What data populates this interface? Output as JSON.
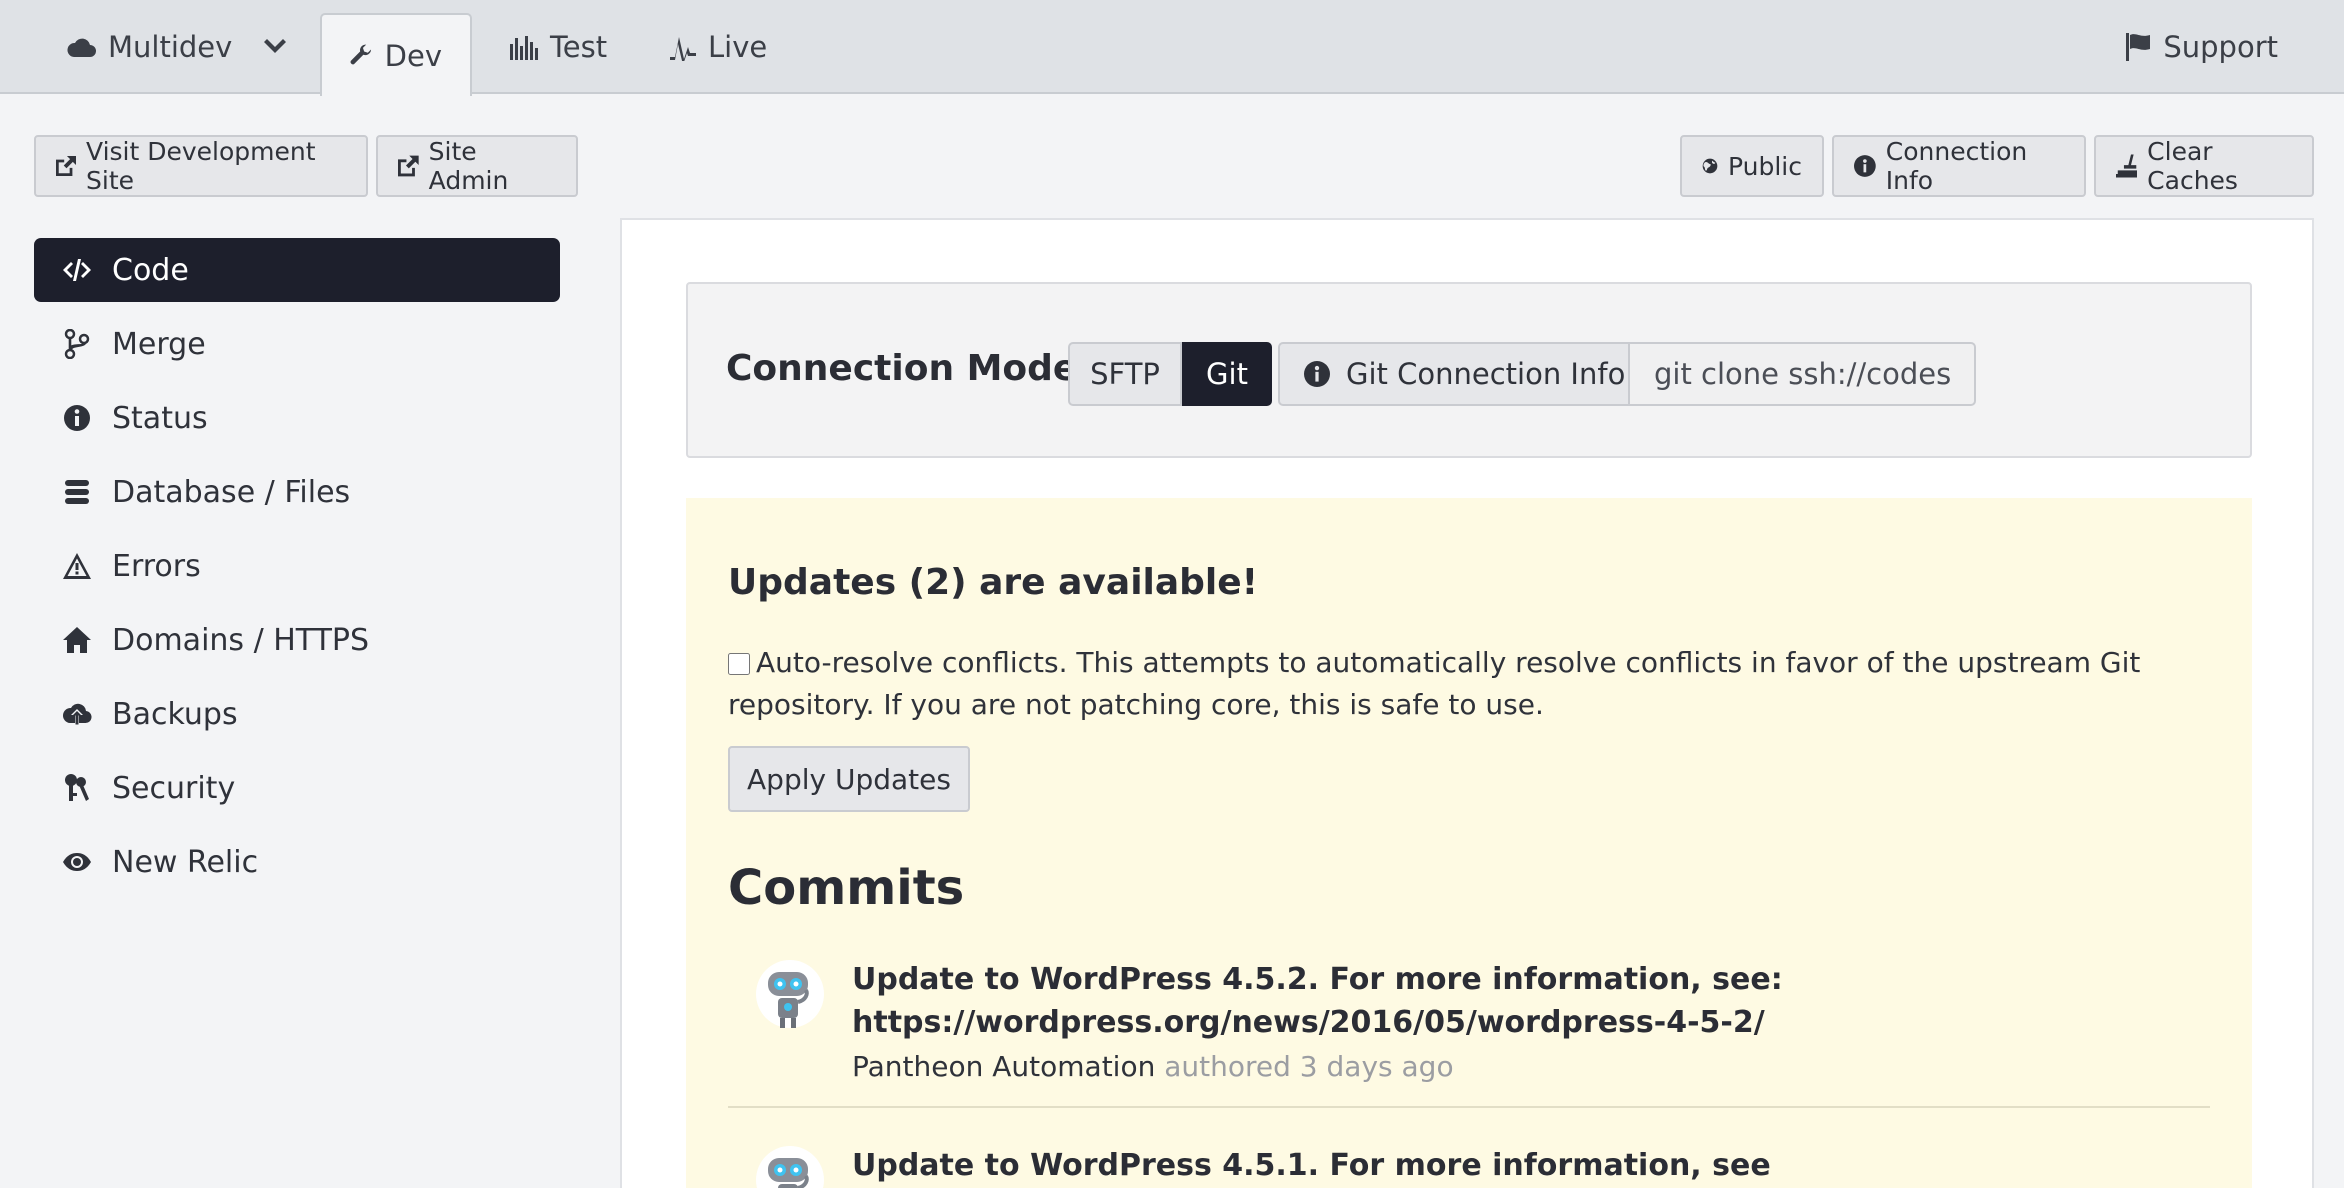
{
  "tabs": {
    "multidev": "Multidev",
    "dev": "Dev",
    "test": "Test",
    "live": "Live",
    "support": "Support"
  },
  "toolbar": {
    "visit_site": "Visit Development Site",
    "site_admin": "Site Admin",
    "public": "Public",
    "connection_info": "Connection Info",
    "clear_caches": "Clear Caches"
  },
  "sidebar": {
    "items": [
      {
        "label": "Code",
        "icon": "code-icon",
        "active": true
      },
      {
        "label": "Merge",
        "icon": "merge-icon"
      },
      {
        "label": "Status",
        "icon": "info-icon"
      },
      {
        "label": "Database / Files",
        "icon": "database-icon"
      },
      {
        "label": "Errors",
        "icon": "warning-icon"
      },
      {
        "label": "Domains / HTTPS",
        "icon": "home-icon"
      },
      {
        "label": "Backups",
        "icon": "cloud-upload-icon"
      },
      {
        "label": "Security",
        "icon": "keys-icon"
      },
      {
        "label": "New Relic",
        "icon": "eye-icon"
      }
    ]
  },
  "connection": {
    "label": "Connection Mode:",
    "sftp": "SFTP",
    "git": "Git",
    "active_mode": "Git",
    "git_info": "Git Connection Info",
    "clone_value": "git clone ssh://codeserver"
  },
  "updates": {
    "title": "Updates (2) are available!",
    "auto_resolve": "Auto-resolve conflicts. This attempts to automatically resolve conflicts in favor of the upstream Git repository. If you are not patching core, this is safe to use.",
    "auto_resolve_checked": false,
    "apply_button": "Apply Updates",
    "commits_title": "Commits",
    "commits": [
      {
        "message": "Update to WordPress 4.5.2. For more information, see: https://wordpress.org/news/2016/05/wordpress-4-5-2/",
        "author": "Pantheon Automation",
        "authored": "authored 3 days ago"
      },
      {
        "message": "Update to WordPress 4.5.1. For more information, see",
        "author": "",
        "authored": ""
      }
    ]
  },
  "colors": {
    "active_dark": "#1d1f2c",
    "updates_bg": "#fefae3",
    "topbar_bg": "#dfe2e6"
  }
}
